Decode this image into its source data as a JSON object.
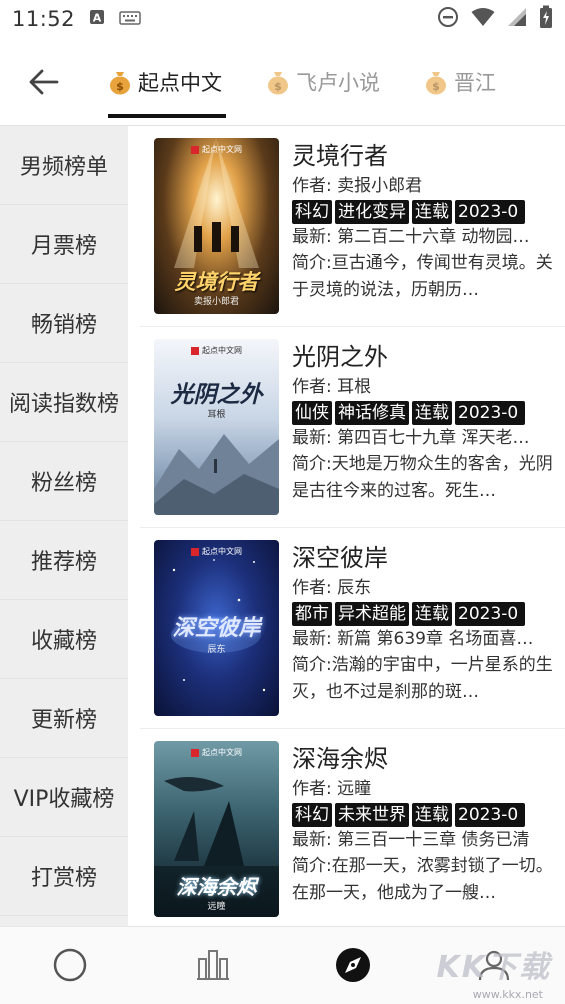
{
  "status_bar": {
    "time": "11:52",
    "icons": [
      "a-notification-icon",
      "keyboard-icon",
      "dnd-icon",
      "wifi-icon",
      "signal-icon",
      "battery-icon"
    ]
  },
  "header": {
    "tabs": [
      {
        "label": "起点中文",
        "active": true
      },
      {
        "label": "飞卢小说",
        "active": false
      },
      {
        "label": "晋江",
        "active": false
      }
    ]
  },
  "sidebar": {
    "items": [
      "男频榜单",
      "月票榜",
      "畅销榜",
      "阅读指数榜",
      "粉丝榜",
      "推荐榜",
      "收藏榜",
      "更新榜",
      "VIP收藏榜",
      "打赏榜"
    ]
  },
  "books": [
    {
      "title": "灵境行者",
      "author": "作者: 卖报小郎君",
      "tags": [
        "科幻",
        "进化变异",
        "连载",
        "2023-0"
      ],
      "latest": "最新: 第二百二十六章 动物园…",
      "intro": "简介:亘古通今，传闻世有灵境。关于灵境的说法，历朝历…",
      "cover_title": "灵境行者",
      "cover_author": "卖报小郎君",
      "cover_pub": "起点中文网"
    },
    {
      "title": "光阴之外",
      "author": "作者: 耳根",
      "tags": [
        "仙侠",
        "神话修真",
        "连载",
        "2023-0"
      ],
      "latest": "最新: 第四百七十九章 浑天老…",
      "intro": "简介:天地是万物众生的客舍，光阴是古往今来的过客。死生…",
      "cover_title": "光阴之外",
      "cover_author": "耳根",
      "cover_pub": "起点中文网"
    },
    {
      "title": "深空彼岸",
      "author": "作者: 辰东",
      "tags": [
        "都市",
        "异术超能",
        "连载",
        "2023-0"
      ],
      "latest": "最新: 新篇 第639章 名场面喜…",
      "intro": "简介:浩瀚的宇宙中，一片星系的生灭，也不过是刹那的斑…",
      "cover_title": "深空彼岸",
      "cover_author": "辰东",
      "cover_pub": "起点中文网"
    },
    {
      "title": "深海余烬",
      "author": "作者: 远瞳",
      "tags": [
        "科幻",
        "未来世界",
        "连载",
        "2023-0"
      ],
      "latest": "最新: 第三百一十三章 债务已清",
      "intro": "简介:在那一天，浓雾封锁了一切。在那一天，他成为了一艘…",
      "cover_title": "深海余烬",
      "cover_author": "远瞳",
      "cover_pub": "起点中文网"
    }
  ],
  "bottom_nav": {
    "items": [
      "circle-icon",
      "bookshelf-icon",
      "compass-icon",
      "user-icon"
    ],
    "active_index": 2
  },
  "watermark": {
    "text": "KK下载",
    "url": "www.kkx.net"
  },
  "colors": {
    "accent": "#111111",
    "sidebar_bg": "#eeeeee",
    "coin": "#e8a33c"
  }
}
